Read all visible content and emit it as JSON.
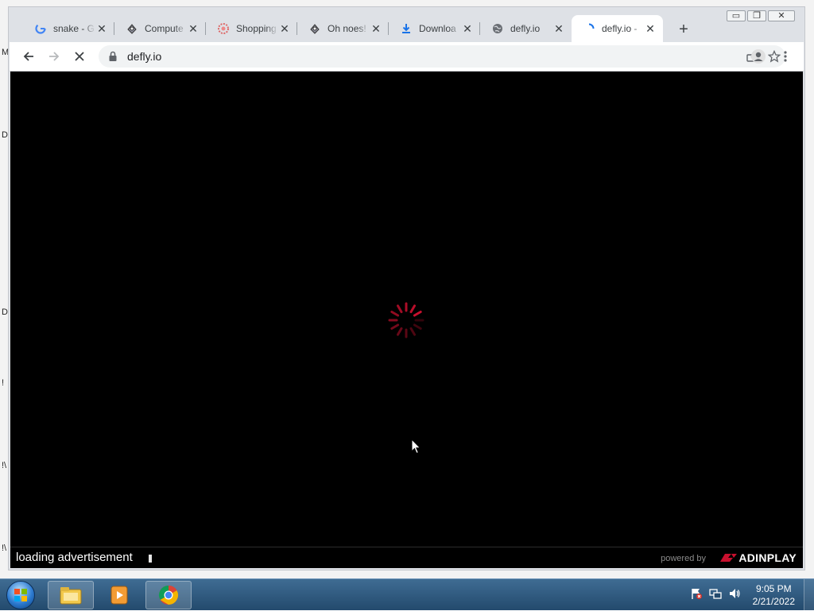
{
  "desktop": {
    "edge_letters": [
      "M",
      "D",
      "D",
      "!",
      "!\\",
      "!\\"
    ]
  },
  "browser": {
    "tabs": [
      {
        "label": "snake - G",
        "icon": "google-icon"
      },
      {
        "label": "Compute",
        "icon": "app-icon"
      },
      {
        "label": "Shopping",
        "icon": "shopping-icon"
      },
      {
        "label": "Oh noes!",
        "icon": "app-icon"
      },
      {
        "label": "Downloa",
        "icon": "download-icon"
      },
      {
        "label": "defly.io",
        "icon": "globe-icon"
      },
      {
        "label": "defly.io -",
        "icon": "loading-icon",
        "active": true
      }
    ],
    "close_glyph": "✕",
    "new_tab_glyph": "+",
    "url": "defly.io",
    "window_controls": [
      "▭",
      "❐",
      "✕"
    ]
  },
  "page": {
    "loading_text": "loading advertisement",
    "powered_by": "powered by",
    "brand": "ADINPLAY",
    "spinner_color": "#c8102e"
  },
  "taskbar": {
    "time": "9:05 PM",
    "date": "2/21/2022"
  }
}
